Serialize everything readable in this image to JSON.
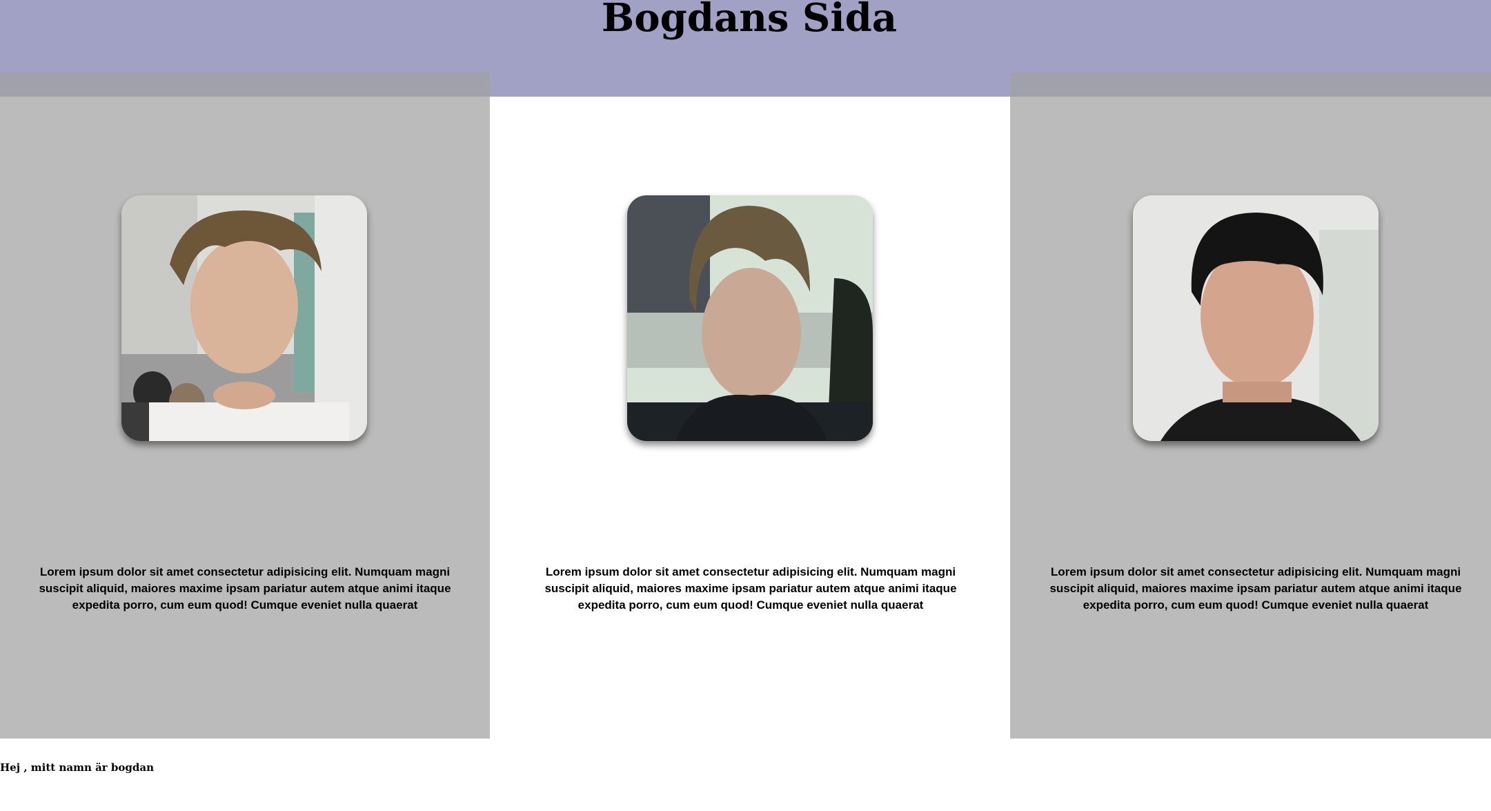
{
  "header": {
    "title": "Bogdans Sida",
    "background_color": "#a1a1c5"
  },
  "cards": [
    {
      "photo_label": "portrait photo of young man with messy brown hair",
      "text": "Lorem ipsum dolor sit amet consectetur adipisicing elit. Numquam magni suscipit aliquid, maiores maxime ipsam pariatur autem atque animi itaque expedita porro, cum eum quod! Cumque eveniet nulla quaerat"
    },
    {
      "photo_label": "portrait photo of young man with swept brown hair",
      "text": "Lorem ipsum dolor sit amet consectetur adipisicing elit. Numquam magni suscipit aliquid, maiores maxime ipsam pariatur autem atque animi itaque expedita porro, cum eum quod! Cumque eveniet nulla quaerat"
    },
    {
      "photo_label": "portrait photo of young man with short black hair",
      "text": "Lorem ipsum dolor sit amet consectetur adipisicing elit. Numquam magni suscipit aliquid, maiores maxime ipsam pariatur autem atque animi itaque expedita porro, cum eum quod! Cumque eveniet nulla quaerat"
    }
  ],
  "footer": {
    "text": "Hej , mitt namn är bogdan"
  },
  "colors": {
    "column_gray": "#bbbbbb",
    "column_white": "#ffffff",
    "strip_gray": "#a1a1ab"
  }
}
